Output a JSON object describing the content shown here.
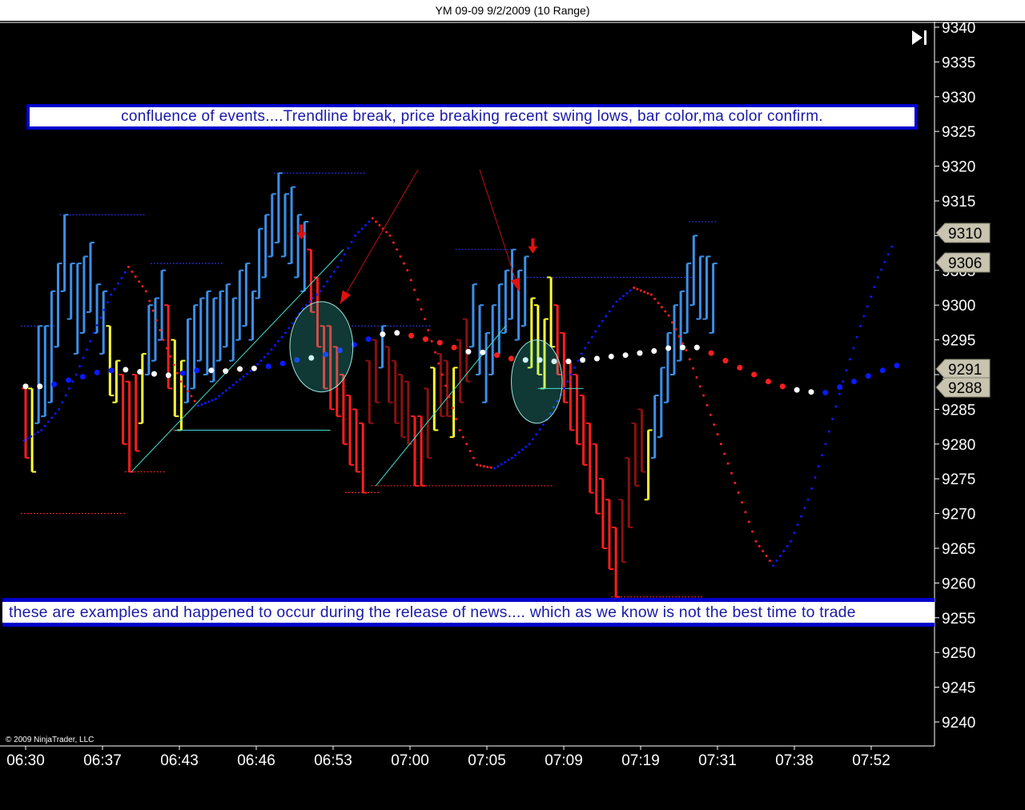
{
  "window": {
    "title": "YM 09-09  9/2/2009 (10 Range)"
  },
  "annotations": {
    "top": "confluence of events....Trendline break, price breaking recent swing lows, bar color,ma color confirm.",
    "bottom": "these are examples and happened to occur during the release of news.... which as we know is not the best time to trade"
  },
  "copyright": "© 2009 NinjaTrader, LLC",
  "controls": {
    "scroll_to_end_icon": "skip-to-end-icon"
  },
  "colors": {
    "background": "#000000",
    "up_bar": "#3c8fe6",
    "down_bar": "#ff1e1e",
    "dark_down_bar": "#8a1010",
    "neutral_bar": "#ffff33",
    "ma_up": "#0a1aff",
    "ma_down": "#ff1e1e",
    "ma_flat": "#ffffff",
    "trendline": "#40e0d0",
    "arrow": "#e01010",
    "annotation_border": "#0000cc",
    "annotation_text": "#1a1aa8"
  },
  "chart_data": {
    "type": "ohlc-range",
    "title": "YM 09-09  9/2/2009 (10 Range)",
    "ylim": [
      9235,
      9340
    ],
    "y_ticks": [
      9340,
      9335,
      9330,
      9325,
      9320,
      9315,
      9310,
      9305,
      9300,
      9295,
      9290,
      9285,
      9280,
      9275,
      9270,
      9265,
      9260,
      9255,
      9250,
      9245,
      9240
    ],
    "x_labels": [
      "06:30",
      "06:37",
      "06:43",
      "06:46",
      "06:53",
      "07:00",
      "07:05",
      "07:09",
      "07:19",
      "07:31",
      "07:38",
      "07:52"
    ],
    "price_markers": [
      9310,
      9306,
      9291,
      9288
    ],
    "grid": false,
    "bars": [
      {
        "low": 9278,
        "high": 9288,
        "c": "red"
      },
      {
        "low": 9276,
        "high": 9288,
        "c": "yellow"
      },
      {
        "low": 9283,
        "high": 9297,
        "c": "blue"
      },
      {
        "low": 9284,
        "high": 9297,
        "c": "blue"
      },
      {
        "low": 9286,
        "high": 9302,
        "c": "blue"
      },
      {
        "low": 9294,
        "high": 9306,
        "c": "blue"
      },
      {
        "low": 9302,
        "high": 9313,
        "c": "blue"
      },
      {
        "low": 9298,
        "high": 9306,
        "c": "blue"
      },
      {
        "low": 9293,
        "high": 9306,
        "c": "blue"
      },
      {
        "low": 9296,
        "high": 9307,
        "c": "blue"
      },
      {
        "low": 9299,
        "high": 9309,
        "c": "blue"
      },
      {
        "low": 9296,
        "high": 9303,
        "c": "blue"
      },
      {
        "low": 9293,
        "high": 9302,
        "c": "blue"
      },
      {
        "low": 9287,
        "high": 9297,
        "c": "yellow"
      },
      {
        "low": 9286,
        "high": 9292,
        "c": "yellow"
      },
      {
        "low": 9280,
        "high": 9290,
        "c": "red"
      },
      {
        "low": 9276,
        "high": 9289,
        "c": "red"
      },
      {
        "low": 9279,
        "high": 9290,
        "c": "red"
      },
      {
        "low": 9283,
        "high": 9293,
        "c": "yellow"
      },
      {
        "low": 9290,
        "high": 9300,
        "c": "blue"
      },
      {
        "low": 9292,
        "high": 9301,
        "c": "blue"
      },
      {
        "low": 9295,
        "high": 9305,
        "c": "blue"
      },
      {
        "low": 9288,
        "high": 9300,
        "c": "red"
      },
      {
        "low": 9284,
        "high": 9295,
        "c": "yellow"
      },
      {
        "low": 9282,
        "high": 9292,
        "c": "yellow"
      },
      {
        "low": 9286,
        "high": 9298,
        "c": "blue"
      },
      {
        "low": 9288,
        "high": 9300,
        "c": "blue"
      },
      {
        "low": 9292,
        "high": 9301,
        "c": "blue"
      },
      {
        "low": 9290,
        "high": 9302,
        "c": "blue"
      },
      {
        "low": 9289,
        "high": 9301,
        "c": "blue"
      },
      {
        "low": 9292,
        "high": 9302,
        "c": "blue"
      },
      {
        "low": 9294,
        "high": 9303,
        "c": "blue"
      },
      {
        "low": 9292,
        "high": 9301,
        "c": "blue"
      },
      {
        "low": 9295,
        "high": 9305,
        "c": "blue"
      },
      {
        "low": 9297,
        "high": 9306,
        "c": "blue"
      },
      {
        "low": 9295,
        "high": 9302,
        "c": "blue"
      },
      {
        "low": 9301,
        "high": 9311,
        "c": "blue"
      },
      {
        "low": 9304,
        "high": 9313,
        "c": "blue"
      },
      {
        "low": 9307,
        "high": 9316,
        "c": "blue"
      },
      {
        "low": 9309,
        "high": 9319,
        "c": "blue"
      },
      {
        "low": 9307,
        "high": 9316,
        "c": "blue"
      },
      {
        "low": 9306,
        "high": 9317,
        "c": "blue"
      },
      {
        "low": 9304,
        "high": 9313,
        "c": "blue"
      },
      {
        "low": 9302,
        "high": 9312,
        "c": "blue"
      },
      {
        "low": 9299,
        "high": 9308,
        "c": "red"
      },
      {
        "low": 9294,
        "high": 9304,
        "c": "red"
      },
      {
        "low": 9288,
        "high": 9297,
        "c": "red"
      },
      {
        "low": 9285,
        "high": 9297,
        "c": "red"
      },
      {
        "low": 9284,
        "high": 9294,
        "c": "red"
      },
      {
        "low": 9280,
        "high": 9290,
        "c": "red"
      },
      {
        "low": 9277,
        "high": 9287,
        "c": "red"
      },
      {
        "low": 9276,
        "high": 9285,
        "c": "red"
      },
      {
        "low": 9273,
        "high": 9283,
        "c": "red"
      },
      {
        "low": 9283,
        "high": 9292,
        "c": "dark"
      },
      {
        "low": 9286,
        "high": 9295,
        "c": "dark"
      },
      {
        "low": 9291,
        "high": 9297,
        "c": "blue"
      },
      {
        "low": 9286,
        "high": 9294,
        "c": "dark"
      },
      {
        "low": 9283,
        "high": 9292,
        "c": "dark"
      },
      {
        "low": 9281,
        "high": 9290,
        "c": "dark"
      },
      {
        "low": 9280,
        "high": 9289,
        "c": "dark"
      },
      {
        "low": 9274,
        "high": 9284,
        "c": "red"
      },
      {
        "low": 9274,
        "high": 9284,
        "c": "red"
      },
      {
        "low": 9278,
        "high": 9288,
        "c": "dark"
      },
      {
        "low": 9282,
        "high": 9291,
        "c": "yellow"
      },
      {
        "low": 9284,
        "high": 9293,
        "c": "dark"
      },
      {
        "low": 9284,
        "high": 9292,
        "c": "dark"
      },
      {
        "low": 9281,
        "high": 9291,
        "c": "yellow"
      },
      {
        "low": 9286,
        "high": 9295,
        "c": "dark"
      },
      {
        "low": 9289,
        "high": 9298,
        "c": "dark"
      },
      {
        "low": 9294,
        "high": 9303,
        "c": "blue"
      },
      {
        "low": 9290,
        "high": 9300,
        "c": "blue"
      },
      {
        "low": 9286,
        "high": 9296,
        "c": "blue"
      },
      {
        "low": 9290,
        "high": 9300,
        "c": "blue"
      },
      {
        "low": 9293,
        "high": 9303,
        "c": "blue"
      },
      {
        "low": 9296,
        "high": 9305,
        "c": "blue"
      },
      {
        "low": 9298,
        "high": 9308,
        "c": "blue"
      },
      {
        "low": 9295,
        "high": 9305,
        "c": "blue"
      },
      {
        "low": 9297,
        "high": 9307,
        "c": "blue"
      },
      {
        "low": 9291,
        "high": 9301,
        "c": "yellow"
      },
      {
        "low": 9290,
        "high": 9300,
        "c": "yellow"
      },
      {
        "low": 9288,
        "high": 9298,
        "c": "yellow"
      },
      {
        "low": 9294,
        "high": 9304,
        "c": "yellow"
      },
      {
        "low": 9290,
        "high": 9300,
        "c": "red"
      },
      {
        "low": 9286,
        "high": 9296,
        "c": "red"
      },
      {
        "low": 9282,
        "high": 9292,
        "c": "red"
      },
      {
        "low": 9280,
        "high": 9290,
        "c": "red"
      },
      {
        "low": 9277,
        "high": 9287,
        "c": "red"
      },
      {
        "low": 9273,
        "high": 9283,
        "c": "red"
      },
      {
        "low": 9270,
        "high": 9280,
        "c": "red"
      },
      {
        "low": 9265,
        "high": 9275,
        "c": "red"
      },
      {
        "low": 9262,
        "high": 9272,
        "c": "red"
      },
      {
        "low": 9258,
        "high": 9268,
        "c": "red"
      },
      {
        "low": 9263,
        "high": 9272,
        "c": "dark"
      },
      {
        "low": 9268,
        "high": 9278,
        "c": "dark"
      },
      {
        "low": 9274,
        "high": 9283,
        "c": "dark"
      },
      {
        "low": 9276,
        "high": 9285,
        "c": "dark"
      },
      {
        "low": 9272,
        "high": 9282,
        "c": "yellow"
      },
      {
        "low": 9278,
        "high": 9287,
        "c": "blue"
      },
      {
        "low": 9281,
        "high": 9291,
        "c": "blue"
      },
      {
        "low": 9286,
        "high": 9296,
        "c": "blue"
      },
      {
        "low": 9290,
        "high": 9300,
        "c": "blue"
      },
      {
        "low": 9292,
        "high": 9302,
        "c": "blue"
      },
      {
        "low": 9296,
        "high": 9306,
        "c": "blue"
      },
      {
        "low": 9300,
        "high": 9310,
        "c": "blue"
      },
      {
        "low": 9298,
        "high": 9307,
        "c": "blue"
      },
      {
        "low": 9298,
        "high": 9307,
        "c": "blue"
      },
      {
        "low": 9296,
        "high": 9306,
        "c": "blue"
      }
    ],
    "slow_ma": [
      {
        "v": 9288.3,
        "c": "white"
      },
      {
        "v": 9288.3,
        "c": "white"
      },
      {
        "v": 9288.6,
        "c": "blue"
      },
      {
        "v": 9289.2,
        "c": "blue"
      },
      {
        "v": 9289.7,
        "c": "blue"
      },
      {
        "v": 9290.3,
        "c": "blue"
      },
      {
        "v": 9290.6,
        "c": "blue"
      },
      {
        "v": 9290.7,
        "c": "white"
      },
      {
        "v": 9290.4,
        "c": "white"
      },
      {
        "v": 9290.1,
        "c": "white"
      },
      {
        "v": 9289.9,
        "c": "white"
      },
      {
        "v": 9290.2,
        "c": "blue"
      },
      {
        "v": 9290.6,
        "c": "blue"
      },
      {
        "v": 9290.6,
        "c": "white"
      },
      {
        "v": 9290.5,
        "c": "white"
      },
      {
        "v": 9290.8,
        "c": "white"
      },
      {
        "v": 9290.9,
        "c": "white"
      },
      {
        "v": 9291.2,
        "c": "blue"
      },
      {
        "v": 9291.6,
        "c": "blue"
      },
      {
        "v": 9292.1,
        "c": "blue"
      },
      {
        "v": 9292.4,
        "c": "white"
      },
      {
        "v": 9292.9,
        "c": "blue"
      },
      {
        "v": 9293.5,
        "c": "blue"
      },
      {
        "v": 9294.3,
        "c": "blue"
      },
      {
        "v": 9295.1,
        "c": "blue"
      },
      {
        "v": 9295.8,
        "c": "white"
      },
      {
        "v": 9296.0,
        "c": "white"
      },
      {
        "v": 9295.6,
        "c": "red"
      },
      {
        "v": 9295.1,
        "c": "red"
      },
      {
        "v": 9294.6,
        "c": "red"
      },
      {
        "v": 9293.9,
        "c": "red"
      },
      {
        "v": 9293.3,
        "c": "white"
      },
      {
        "v": 9293.2,
        "c": "white"
      },
      {
        "v": 9292.8,
        "c": "red"
      },
      {
        "v": 9292.3,
        "c": "red"
      },
      {
        "v": 9292.1,
        "c": "white"
      },
      {
        "v": 9292.1,
        "c": "white"
      },
      {
        "v": 9291.9,
        "c": "white"
      },
      {
        "v": 9291.9,
        "c": "white"
      },
      {
        "v": 9292.1,
        "c": "white"
      },
      {
        "v": 9292.3,
        "c": "white"
      },
      {
        "v": 9292.6,
        "c": "white"
      },
      {
        "v": 9292.8,
        "c": "white"
      },
      {
        "v": 9293.1,
        "c": "white"
      },
      {
        "v": 9293.4,
        "c": "white"
      },
      {
        "v": 9293.8,
        "c": "white"
      },
      {
        "v": 9293.9,
        "c": "white"
      },
      {
        "v": 9293.9,
        "c": "white"
      },
      {
        "v": 9293.1,
        "c": "red"
      },
      {
        "v": 9292.0,
        "c": "red"
      },
      {
        "v": 9291.0,
        "c": "red"
      },
      {
        "v": 9290.0,
        "c": "red"
      },
      {
        "v": 9289.0,
        "c": "red"
      },
      {
        "v": 9288.3,
        "c": "red"
      },
      {
        "v": 9287.8,
        "c": "white"
      },
      {
        "v": 9287.5,
        "c": "white"
      },
      {
        "v": 9287.4,
        "c": "blue"
      },
      {
        "v": 9288.2,
        "c": "blue"
      },
      {
        "v": 9289.0,
        "c": "blue"
      },
      {
        "v": 9289.8,
        "c": "blue"
      },
      {
        "v": 9290.6,
        "c": "blue"
      },
      {
        "v": 9291.3,
        "c": "blue"
      }
    ],
    "fast_ma": [
      {
        "v": 9280.5,
        "c": "blue"
      },
      {
        "v": 9282.0,
        "c": "blue"
      },
      {
        "v": 9285.0,
        "c": "blue"
      },
      {
        "v": 9290.0,
        "c": "blue"
      },
      {
        "v": 9296.0,
        "c": "blue"
      },
      {
        "v": 9301.5,
        "c": "blue"
      },
      {
        "v": 9305.5,
        "c": "red"
      },
      {
        "v": 9302.0,
        "c": "red"
      },
      {
        "v": 9295.0,
        "c": "red"
      },
      {
        "v": 9289.0,
        "c": "red"
      },
      {
        "v": 9285.5,
        "c": "blue"
      },
      {
        "v": 9286.5,
        "c": "blue"
      },
      {
        "v": 9288.5,
        "c": "blue"
      },
      {
        "v": 9290.5,
        "c": "blue"
      },
      {
        "v": 9293.0,
        "c": "blue"
      },
      {
        "v": 9296.0,
        "c": "blue"
      },
      {
        "v": 9299.5,
        "c": "blue"
      },
      {
        "v": 9302.0,
        "c": "blue"
      },
      {
        "v": 9305.5,
        "c": "blue"
      },
      {
        "v": 9310.0,
        "c": "blue"
      },
      {
        "v": 9312.5,
        "c": "red"
      },
      {
        "v": 9310.0,
        "c": "red"
      },
      {
        "v": 9305.0,
        "c": "red"
      },
      {
        "v": 9298.0,
        "c": "red"
      },
      {
        "v": 9290.0,
        "c": "red"
      },
      {
        "v": 9282.0,
        "c": "red"
      },
      {
        "v": 9277.0,
        "c": "red"
      },
      {
        "v": 9276.5,
        "c": "blue"
      },
      {
        "v": 9278.0,
        "c": "blue"
      },
      {
        "v": 9280.0,
        "c": "blue"
      },
      {
        "v": 9283.5,
        "c": "blue"
      },
      {
        "v": 9288.0,
        "c": "blue"
      },
      {
        "v": 9293.0,
        "c": "blue"
      },
      {
        "v": 9297.0,
        "c": "blue"
      },
      {
        "v": 9300.5,
        "c": "blue"
      },
      {
        "v": 9302.5,
        "c": "red"
      },
      {
        "v": 9301.5,
        "c": "red"
      },
      {
        "v": 9298.5,
        "c": "red"
      },
      {
        "v": 9293.5,
        "c": "red"
      },
      {
        "v": 9287.0,
        "c": "red"
      },
      {
        "v": 9280.0,
        "c": "red"
      },
      {
        "v": 9273.0,
        "c": "red"
      },
      {
        "v": 9266.0,
        "c": "red"
      },
      {
        "v": 9262.5,
        "c": "blue"
      },
      {
        "v": 9266.0,
        "c": "blue"
      },
      {
        "v": 9272.0,
        "c": "blue"
      },
      {
        "v": 9280.0,
        "c": "blue"
      },
      {
        "v": 9289.0,
        "c": "blue"
      },
      {
        "v": 9297.0,
        "c": "blue"
      },
      {
        "v": 9304.0,
        "c": "blue"
      },
      {
        "v": 9309.5,
        "c": "blue"
      }
    ],
    "swing_highs": [
      {
        "v": 9297,
        "from": 0,
        "to": 4
      },
      {
        "v": 9313,
        "from": 6,
        "to": 18
      },
      {
        "v": 9306,
        "from": 20,
        "to": 30
      },
      {
        "v": 9319,
        "from": 39,
        "to": 52
      },
      {
        "v": 9297,
        "from": 51,
        "to": 62
      },
      {
        "v": 9308,
        "from": 67,
        "to": 75
      },
      {
        "v": 9304,
        "from": 78,
        "to": 103
      },
      {
        "v": 9312,
        "from": 103,
        "to": 106
      }
    ],
    "swing_lows": [
      {
        "v": 9270,
        "from": 0,
        "to": 15
      },
      {
        "v": 9276,
        "from": 16,
        "to": 21
      },
      {
        "v": 9282,
        "from": 23,
        "to": 46
      },
      {
        "v": 9273,
        "from": 50,
        "to": 54
      },
      {
        "v": 9274,
        "from": 54,
        "to": 81
      },
      {
        "v": 9258,
        "from": 91,
        "to": 104
      }
    ],
    "trendlines": [
      {
        "x1": 16.3,
        "y1": 9276,
        "x2": 49,
        "y2": 9308
      },
      {
        "x1": 23,
        "y1": 9282,
        "x2": 47,
        "y2": 9282
      },
      {
        "x1": 54,
        "y1": 9274,
        "x2": 74,
        "y2": 9297
      },
      {
        "x1": 79,
        "y1": 9288,
        "x2": 86,
        "y2": 9288
      }
    ],
    "ellipses": [
      {
        "cx": 45.6,
        "cy": 9294,
        "rx": 3.6,
        "ry": 6.5
      },
      {
        "cx": 78.8,
        "cy": 9289,
        "rx": 2.9,
        "ry": 6
      }
    ],
    "down_arrows": [
      {
        "x": 42.5,
        "v": 9310
      },
      {
        "x": 78.2,
        "v": 9308
      }
    ],
    "pointer_lines": [
      {
        "x1": 60.5,
        "y1": 9319.5,
        "x2": 48.5,
        "y2": 9300.2
      },
      {
        "x1": 70,
        "y1": 9319.5,
        "x2": 76.1,
        "y2": 9302
      }
    ]
  }
}
